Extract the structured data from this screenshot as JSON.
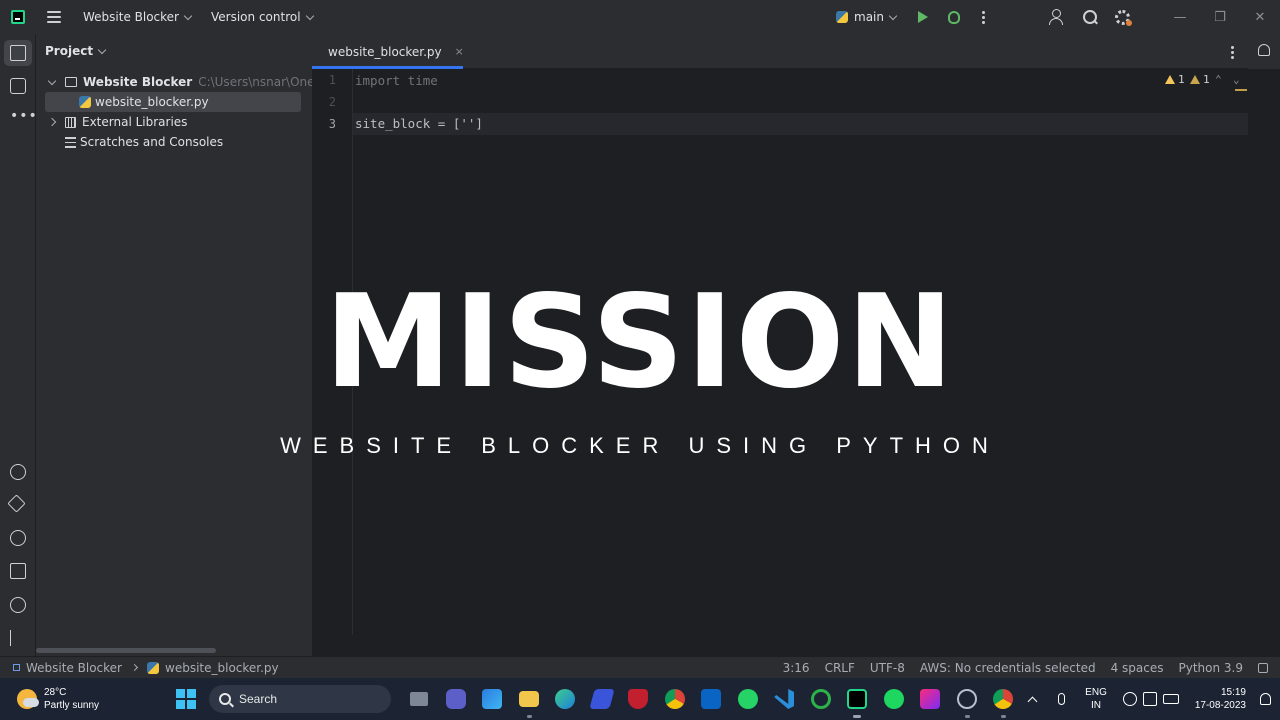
{
  "titlebar": {
    "project_name": "Website Blocker",
    "vcs_menu": "Version control",
    "branch": "main"
  },
  "project_panel": {
    "title": "Project",
    "tree": [
      {
        "label": "Website Blocker",
        "path": "C:\\Users\\nsnar\\OneDrive\\",
        "expanded": true,
        "icon": "folder-icon"
      },
      {
        "label": "website_blocker.py",
        "icon": "python-file-icon",
        "selected": true
      },
      {
        "label": "External Libraries",
        "icon": "libraries-icon",
        "expanded": false
      },
      {
        "label": "Scratches and Consoles",
        "icon": "scratches-icon"
      }
    ]
  },
  "editor": {
    "tab": {
      "label": "website_blocker.py",
      "close": "×"
    },
    "lines": [
      {
        "num": "1",
        "text": "import time"
      },
      {
        "num": "2",
        "text": ""
      },
      {
        "num": "3",
        "text": "site_block = ['']"
      }
    ],
    "inspections": {
      "warnings_a": "1",
      "warnings_b": "1"
    },
    "colors": {
      "accent": "#3574f0",
      "warning": "#f2c55c"
    }
  },
  "overlay": {
    "title": "MISSION",
    "subtitle": "WEBSITE BLOCKER USING PYTHON"
  },
  "statusbar": {
    "crumb_project": "Website Blocker",
    "crumb_file": "website_blocker.py",
    "position": "3:16",
    "line_sep": "CRLF",
    "encoding": "UTF-8",
    "aws": "AWS: No credentials selected",
    "indent": "4 spaces",
    "interpreter": "Python 3.9"
  },
  "taskbar": {
    "weather_temp": "28°C",
    "weather_desc": "Partly sunny",
    "search_label": "Search",
    "apps": [
      "file-explorer-icon",
      "teams-icon",
      "store-icon",
      "folder-icon",
      "edge-icon",
      "powerautomate-icon",
      "mcafee-icon",
      "chrome-icon",
      "outlook-icon",
      "whatsapp-icon",
      "vscode-icon",
      "spinner-icon",
      "pycharm-icon",
      "spotify-icon",
      "jetbrains-icon",
      "app-icon",
      "chrome-profile-icon"
    ],
    "lang_1": "ENG",
    "lang_2": "IN",
    "time": "15:19",
    "date": "17-08-2023"
  }
}
